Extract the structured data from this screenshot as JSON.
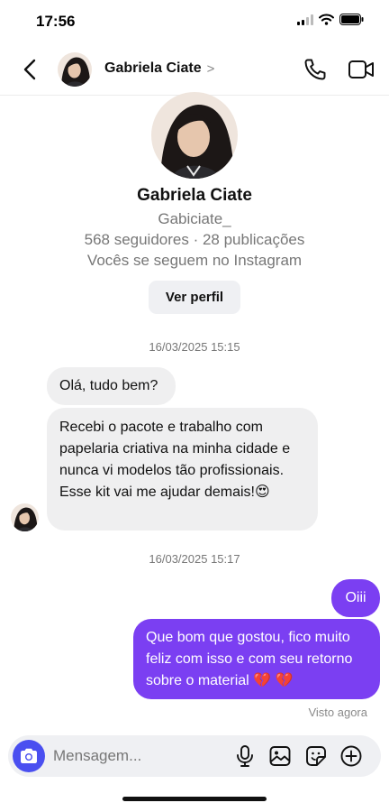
{
  "status_bar": {
    "time": "17:56"
  },
  "header": {
    "name": "Gabriela Ciate"
  },
  "profile": {
    "name": "Gabriela Ciate",
    "username": "Gabiciate_",
    "stats": "568 seguidores · 28 publicações",
    "follow_status": "Vocês se seguem no Instagram",
    "view_profile_label": "Ver perfil"
  },
  "messages": [
    {
      "timestamp": "16/03/2025 15:15"
    },
    {
      "text": "Olá, tudo bem?"
    },
    {
      "text": "Recebi o pacote e trabalho com papelaria criativa na minha cidade e nunca vi modelos tão profissionais. Esse kit vai me ajudar demais!😍"
    },
    {
      "timestamp": "16/03/2025 15:17"
    },
    {
      "text": "Oiii"
    },
    {
      "text": "Que bom que gostou, fico muito feliz com isso e com seu retorno sobre o material 💔 💔"
    }
  ],
  "seen_status": "Visto agora",
  "composer": {
    "placeholder": "Mensagem..."
  },
  "colors": {
    "accent": "#7b3ff2",
    "camera": "#4a4ff0",
    "incoming_bubble": "#efeff0"
  },
  "icons": [
    "back-icon",
    "chevron-right-icon",
    "phone-icon",
    "video-camera-icon",
    "camera-icon",
    "microphone-icon",
    "gallery-icon",
    "sticker-icon",
    "plus-icon"
  ]
}
